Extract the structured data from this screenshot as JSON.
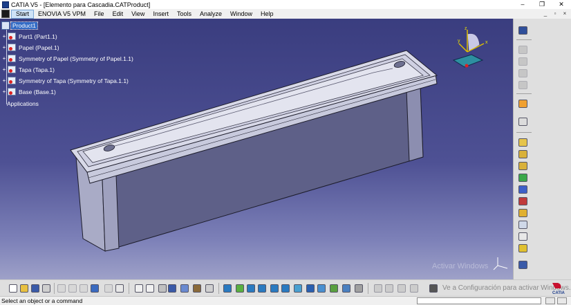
{
  "window": {
    "title": "CATIA V5 - [Elemento para Cascadia.CATProduct]",
    "controls": [
      "–",
      "❐",
      "✕"
    ],
    "mdi_controls": [
      "_",
      "▫",
      "×"
    ]
  },
  "menu": {
    "items": [
      "Start",
      "ENOVIA V5 VPM",
      "File",
      "Edit",
      "View",
      "Insert",
      "Tools",
      "Analyze",
      "Window",
      "Help"
    ]
  },
  "tree": {
    "root": "Product1",
    "children": [
      "Part1 (Part1.1)",
      "Papel (Papel.1)",
      "Symmetry of Papel (Symmetry of Papel.1.1)",
      "Tapa (Tapa.1)",
      "Symmetry of Tapa (Symmetry of Tapa.1.1)",
      "Base (Base.1)"
    ],
    "applications": "Applications"
  },
  "compass": {
    "x_label": "x",
    "y_label": "y",
    "z_label": "z"
  },
  "watermark": {
    "line1": "Activar Windows",
    "line2": "Ve a Configuración para activar Windows."
  },
  "brand": {
    "logo_text": "CATIA",
    "accent": "#c8102e"
  },
  "status": {
    "message": "Select an object or a command",
    "command_value": ""
  },
  "colors": {
    "viewport_top": "#3a3d7f",
    "viewport_bottom": "#9ea1c8",
    "selection": "#316ac5"
  }
}
